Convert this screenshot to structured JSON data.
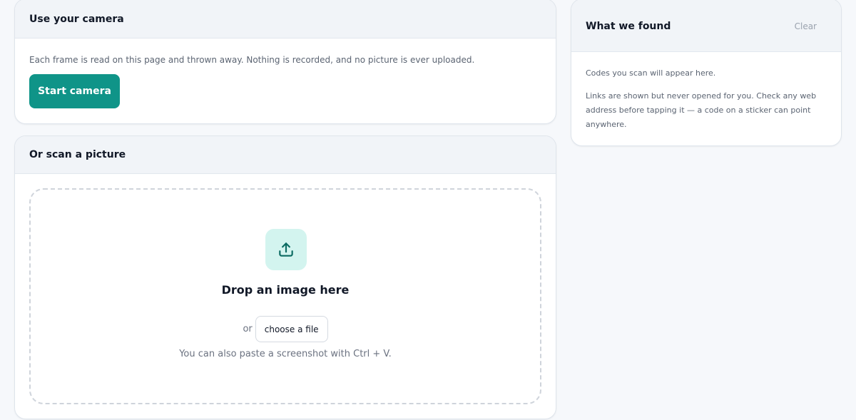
{
  "camera": {
    "title": "Use your camera",
    "description": "Each frame is read on this page and thrown away. Nothing is recorded, and no picture is ever uploaded.",
    "start_label": "Start camera"
  },
  "picture": {
    "title": "Or scan a picture",
    "upload_icon": "upload-icon",
    "drop_title": "Drop an image here",
    "or_text": "or",
    "choose_label": "choose a file",
    "paste_hint": "You can also paste a screenshot with Ctrl + V."
  },
  "results": {
    "title": "What we found",
    "clear_label": "Clear",
    "empty_text": "Codes you scan will appear here.",
    "warning_text": "Links are shown but never opened for you. Check any web address before tapping it — a code on a sticker can point anywhere."
  },
  "colors": {
    "accent": "#0f9488",
    "accent_soft": "#d3f4ef",
    "page_bg": "#f6f8fb"
  }
}
